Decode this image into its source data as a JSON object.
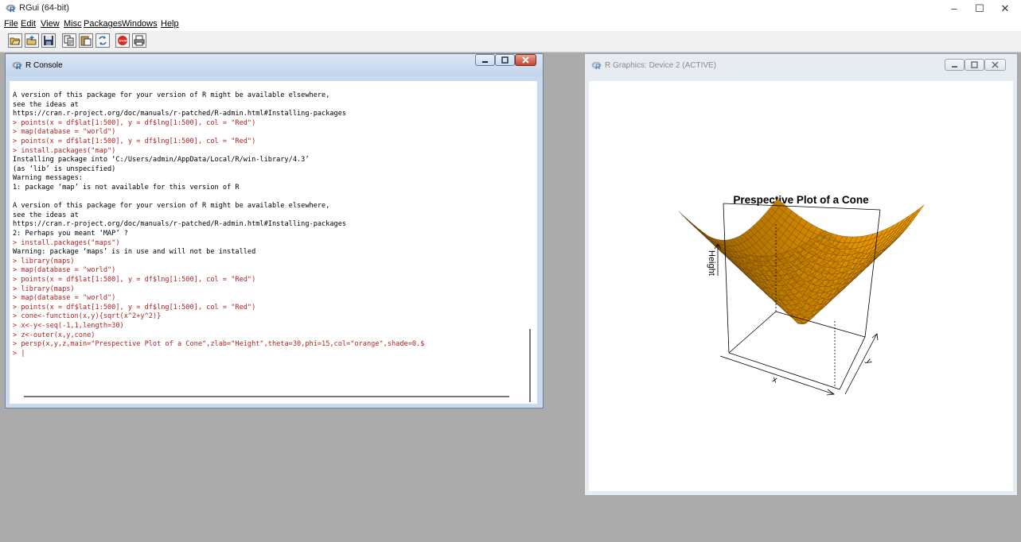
{
  "app": {
    "title": "RGui (64-bit)",
    "minimize": "–",
    "maximize": "☐",
    "close": "✕"
  },
  "menu": [
    "File",
    "Edit",
    "View",
    "Misc",
    "Packages",
    "Windows",
    "Help"
  ],
  "toolbar": {
    "icons": [
      "open-script-icon",
      "load-workspace-icon",
      "save-workspace-icon",
      "copy-icon",
      "paste-icon",
      "copy-paste-icon",
      "stop-icon",
      "print-icon"
    ]
  },
  "console": {
    "title": "R Console",
    "lines": [
      {
        "text": "A version of this package for your version of R might be available elsewhere,",
        "type": "out"
      },
      {
        "text": "see the ideas at",
        "type": "out"
      },
      {
        "text": "https://cran.r-project.org/doc/manuals/r-patched/R-admin.html#Installing-packages",
        "type": "out"
      },
      {
        "text": "> points(x = df$lat[1:500], y = df$lng[1:500], col = \"Red\")",
        "type": "cmd"
      },
      {
        "text": "> map(database = \"world\")",
        "type": "cmd"
      },
      {
        "text": "> points(x = df$lat[1:500], y = df$lng[1:500], col = \"Red\")",
        "type": "cmd"
      },
      {
        "text": "> install.packages(\"map\")",
        "type": "cmd"
      },
      {
        "text": "Installing package into ‘C:/Users/admin/AppData/Local/R/win-library/4.3’",
        "type": "out"
      },
      {
        "text": "(as ‘lib’ is unspecified)",
        "type": "out"
      },
      {
        "text": "Warning messages:",
        "type": "out"
      },
      {
        "text": "1: package ‘map’ is not available for this version of R",
        "type": "out"
      },
      {
        "text": "",
        "type": "out"
      },
      {
        "text": "A version of this package for your version of R might be available elsewhere,",
        "type": "out"
      },
      {
        "text": "see the ideas at",
        "type": "out"
      },
      {
        "text": "https://cran.r-project.org/doc/manuals/r-patched/R-admin.html#Installing-packages",
        "type": "out"
      },
      {
        "text": "2: Perhaps you meant ‘MAP’ ?",
        "type": "out"
      },
      {
        "text": "> install.packages(\"maps\")",
        "type": "cmd"
      },
      {
        "text": "Warning: package ‘maps’ is in use and will not be installed",
        "type": "out"
      },
      {
        "text": "> library(maps)",
        "type": "cmd"
      },
      {
        "text": "> map(database = \"world\")",
        "type": "cmd"
      },
      {
        "text": "> points(x = df$lat[1:500], y = df$lng[1:500], col = \"Red\")",
        "type": "cmd"
      },
      {
        "text": "> library(maps)",
        "type": "cmd"
      },
      {
        "text": "> map(database = \"world\")",
        "type": "cmd"
      },
      {
        "text": "> points(x = df$lat[1:500], y = df$lng[1:500], col = \"Red\")",
        "type": "cmd"
      },
      {
        "text": "> cone<-function(x,y){sqrt(x^2+y^2)}",
        "type": "cmd"
      },
      {
        "text": "> x<-y<-seq(-1,1,length=30)",
        "type": "cmd"
      },
      {
        "text": "> z<-outer(x,y,cone)",
        "type": "cmd"
      },
      {
        "text": "> persp(x,y,z,main=\"Prespective Plot of a Cone\",zlab=\"Height\",theta=30,phi=15,col=\"orange\",shade=0.$",
        "type": "cmd"
      },
      {
        "text": "> |",
        "type": "cmd"
      }
    ]
  },
  "graphics": {
    "title": "R Graphics: Device 2 (ACTIVE)",
    "plot_title": "Prespective Plot of a Cone",
    "axis_x": "x",
    "axis_y": "y",
    "axis_z": "Height",
    "surface_color": "#ffa500"
  }
}
